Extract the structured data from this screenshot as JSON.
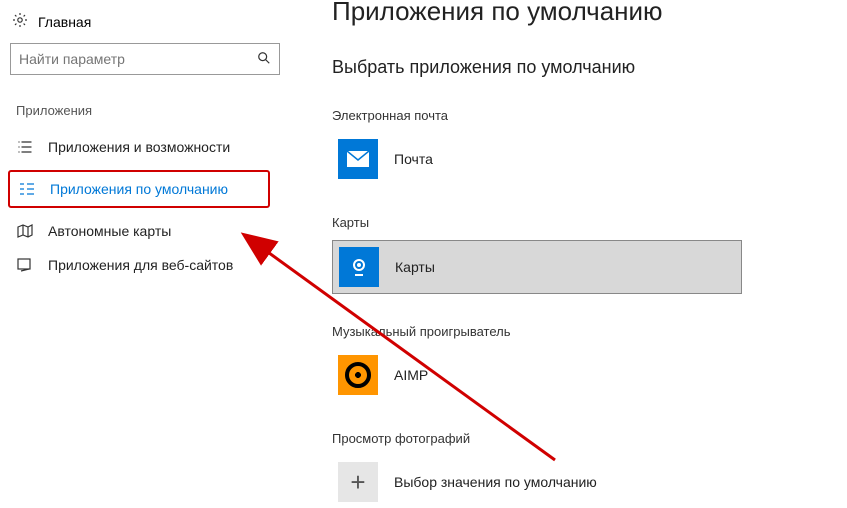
{
  "sidebar": {
    "home_label": "Главная",
    "search_placeholder": "Найти параметр",
    "section_title": "Приложения",
    "items": [
      {
        "label": "Приложения и возможности"
      },
      {
        "label": "Приложения по умолчанию"
      },
      {
        "label": "Автономные карты"
      },
      {
        "label": "Приложения для веб-сайтов"
      }
    ]
  },
  "main": {
    "title": "Приложения по умолчанию",
    "subtitle": "Выбрать приложения по умолчанию",
    "groups": [
      {
        "label": "Электронная почта",
        "app": "Почта",
        "icon": "mail",
        "tile_color": "#0078d7"
      },
      {
        "label": "Карты",
        "app": "Карты",
        "icon": "maps",
        "tile_color": "#0078d7",
        "hover": true
      },
      {
        "label": "Музыкальный проигрыватель",
        "app": "AIMP",
        "icon": "aimp",
        "tile_color": "#ff9500"
      },
      {
        "label": "Просмотр фотографий",
        "app": "Выбор значения по умолчанию",
        "icon": "plus",
        "tile_color": "#e6e6e6"
      }
    ]
  }
}
